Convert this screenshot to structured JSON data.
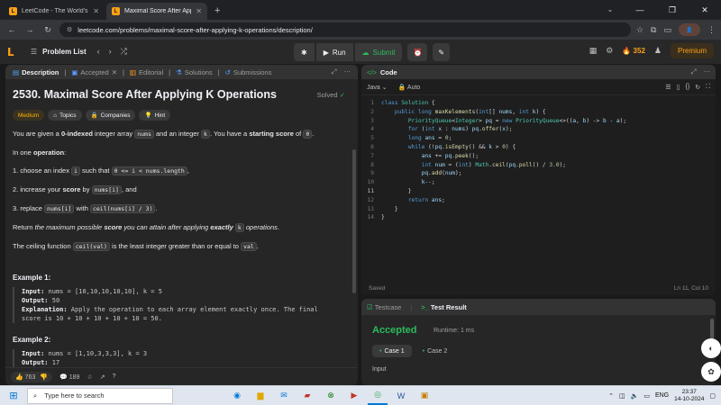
{
  "browser": {
    "tabs": [
      {
        "title": "LeetCode - The World's Leading",
        "active": false
      },
      {
        "title": "Maximal Score After Applying K",
        "active": true
      }
    ],
    "url": "leetcode.com/problems/maximal-score-after-applying-k-operations/description/"
  },
  "nav": {
    "problem_list": "Problem List",
    "run": "Run",
    "submit": "Submit",
    "streak": "352",
    "premium": "Premium"
  },
  "left_tabs": [
    {
      "label": "Description"
    },
    {
      "label": "Accepted"
    },
    {
      "label": "Editorial"
    },
    {
      "label": "Solutions"
    },
    {
      "label": "Submissions"
    }
  ],
  "problem": {
    "title": "2530. Maximal Score After Applying K Operations",
    "solved": "Solved",
    "chips": {
      "difficulty": "Medium",
      "topics": "Topics",
      "companies": "Companies",
      "hint": "Hint"
    },
    "p1": {
      "a": "You are given a ",
      "b": "0-indexed",
      "c": " integer array ",
      "d": "nums",
      "e": " and an integer ",
      "f": "k",
      "g": ". You have a ",
      "h": "starting score",
      "i": " of ",
      "j": "0",
      "k": "."
    },
    "p2": {
      "a": "In one ",
      "b": "operation",
      "c": ":"
    },
    "l1": {
      "a": "1. choose an index ",
      "b": "i",
      "c": " such that ",
      "d": "0 <= i < nums.length",
      "e": ","
    },
    "l2": {
      "a": "2. increase your ",
      "b": "score",
      "c": " by ",
      "d": "nums[i]",
      "e": ", and"
    },
    "l3": {
      "a": "3. replace ",
      "b": "nums[i]",
      "c": " with ",
      "d": "ceil(nums[i] / 3)",
      "e": "."
    },
    "p3": {
      "a": "Return ",
      "b": "the maximum possible ",
      "c": "score",
      "d": " you can attain after applying ",
      "e": "exactly",
      "f": " ",
      "g": "k",
      "h": " operations",
      "i": "."
    },
    "p4": {
      "a": "The ceiling function ",
      "b": "ceil(val)",
      "c": " is the least integer greater than or equal to ",
      "d": "val",
      "e": "."
    },
    "ex1": {
      "head": "Example 1:",
      "input_label": "Input:",
      "input": " nums = [10,10,10,10,10], k = 5",
      "output_label": "Output:",
      "output": " 50",
      "expl_label": "Explanation:",
      "expl1": " Apply the operation to each array element exactly once. The final",
      "expl2": "score is 10 + 10 + 10 + 10 + 10 = 50."
    },
    "ex2": {
      "head": "Example 2:",
      "input_label": "Input:",
      "input": " nums = [1,10,3,3,3], k = 3",
      "output_label": "Output:",
      "output": " 17"
    },
    "likes": "763",
    "comments": "189"
  },
  "code": {
    "tab": "Code",
    "language": "Java",
    "auto": "Auto",
    "lines": [
      {
        "n": "1"
      },
      {
        "n": "2"
      },
      {
        "n": "3"
      },
      {
        "n": "4"
      },
      {
        "n": "5"
      },
      {
        "n": "6"
      },
      {
        "n": "7"
      },
      {
        "n": "8"
      },
      {
        "n": "9"
      },
      {
        "n": "10"
      },
      {
        "n": "11"
      },
      {
        "n": "12"
      },
      {
        "n": "13"
      },
      {
        "n": "14"
      }
    ],
    "status": "Saved",
    "cursor": "Ln 11, Col 10"
  },
  "result": {
    "testcase_tab": "Testcase",
    "result_tab": "Test Result",
    "verdict": "Accepted",
    "runtime": "Runtime: 1 ms",
    "case1": "Case 1",
    "case2": "Case 2",
    "input_label": "Input"
  },
  "taskbar": {
    "search_placeholder": "Type here to search",
    "lang": "ENG",
    "time": "23:37",
    "date": "14-10-2024"
  },
  "colors": {
    "accent": "#ffa116",
    "success": "#2cbb5d",
    "medium": "#ffb800"
  }
}
